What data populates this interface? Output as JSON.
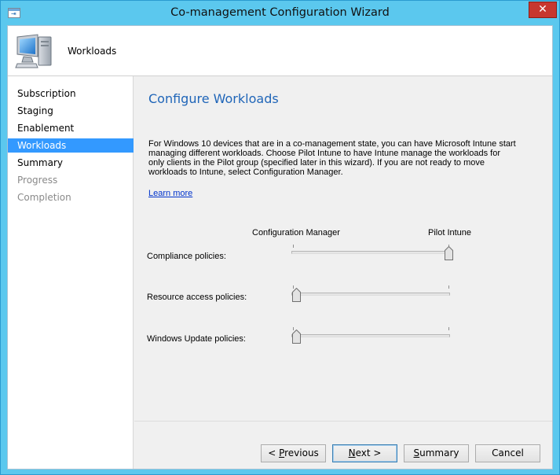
{
  "window": {
    "title": "Co-management Configuration Wizard",
    "close_glyph": "✕",
    "sys_icon_glyph": "⇥"
  },
  "header": {
    "title": "Workloads",
    "icon": "computer-icon"
  },
  "sidebar": {
    "items": [
      {
        "label": "Subscription",
        "state": "normal"
      },
      {
        "label": "Staging",
        "state": "normal"
      },
      {
        "label": "Enablement",
        "state": "normal"
      },
      {
        "label": "Workloads",
        "state": "active"
      },
      {
        "label": "Summary",
        "state": "normal"
      },
      {
        "label": "Progress",
        "state": "disabled"
      },
      {
        "label": "Completion",
        "state": "disabled"
      }
    ]
  },
  "main": {
    "title": "Configure Workloads",
    "description": "For Windows 10 devices that are in a co-management state, you can have Microsoft Intune start managing different workloads. Choose Pilot Intune to have Intune manage the workloads for only clients in the Pilot group (specified later in this wizard). If you are not ready to move workloads to Intune, select Configuration Manager.",
    "learn_more": "Learn more",
    "slider_labels": {
      "left": "Configuration Manager",
      "right": "Pilot Intune"
    },
    "workloads": [
      {
        "label": "Compliance policies:",
        "value": "Pilot Intune",
        "position": 1
      },
      {
        "label": "Resource access policies:",
        "value": "Configuration Manager",
        "position": 0
      },
      {
        "label": "Windows Update policies:",
        "value": "Configuration Manager",
        "position": 0
      }
    ]
  },
  "buttons": {
    "previous": {
      "prefix": "< ",
      "mnemonic": "P",
      "rest": "revious"
    },
    "next": {
      "mnemonic": "N",
      "rest": "ext >"
    },
    "summary": {
      "mnemonic": "S",
      "rest": "ummary"
    },
    "cancel": {
      "label": "Cancel"
    }
  },
  "colors": {
    "titlebar": "#5bc8ee",
    "selection": "#3399ff",
    "page_title": "#1f65b8",
    "link": "#0033cc",
    "close": "#c7372f"
  }
}
